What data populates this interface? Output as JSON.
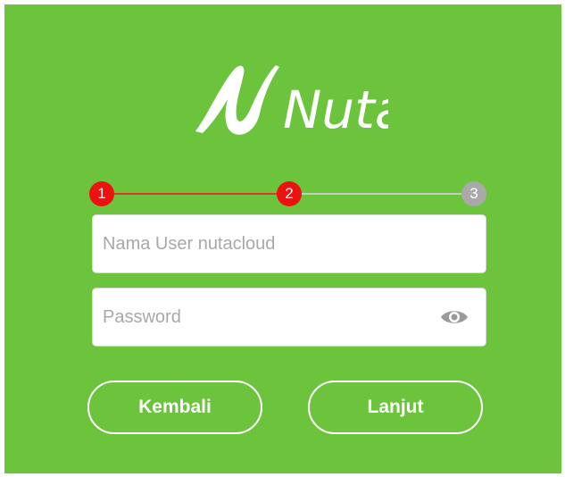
{
  "brand": {
    "logo_text": "Nuta",
    "background_color": "#6cc43c"
  },
  "stepper": {
    "steps": [
      {
        "label": "1",
        "state": "done",
        "color": "#ee1111"
      },
      {
        "label": "2",
        "state": "current",
        "color": "#ee1111"
      },
      {
        "label": "3",
        "state": "pending",
        "color": "#a9a9a9"
      }
    ],
    "progress_color": "#e0352b",
    "pending_color": "#c8c8c8"
  },
  "form": {
    "username": {
      "placeholder": "Nama User nutacloud",
      "value": ""
    },
    "password": {
      "placeholder": "Password",
      "value": "",
      "toggle_icon": "eye-icon"
    }
  },
  "actions": {
    "back_label": "Kembali",
    "next_label": "Lanjut"
  }
}
